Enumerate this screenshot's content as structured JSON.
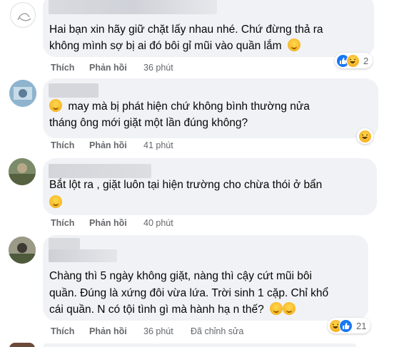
{
  "comments": [
    {
      "text_lines": [
        "Hai bạn xin hãy giữ chặt lấy nhau nhé. Chứ đừng thả ra",
        "không mình sợ bị ai đó bôi gỉ mũi vào quần lắm"
      ],
      "trailing_emoji": "confused-face-icon",
      "actions": {
        "like": "Thích",
        "reply": "Phản hồi",
        "time": "36 phút"
      },
      "reactions": {
        "icons": [
          "like-icon",
          "haha-icon"
        ],
        "count": "2"
      }
    },
    {
      "text_lines": [
        "may mà bị phát hiện chứ không bình thường nửa",
        "tháng ông mới giặt một lần đúng không?"
      ],
      "leading_emoji": "laughing-face-icon",
      "actions": {
        "like": "Thích",
        "reply": "Phản hồi",
        "time": "41 phút"
      },
      "reactions": {
        "icons": [
          "haha-icon"
        ],
        "count": ""
      }
    },
    {
      "text_lines": [
        "Bắt lột ra , giặt luôn tại hiện trường cho chừa thói ở bẩn"
      ],
      "second_line_emoji": "upside-down-face-icon",
      "actions": {
        "like": "Thích",
        "reply": "Phản hồi",
        "time": "40 phút"
      }
    },
    {
      "text_lines": [
        "Chàng thì 5 ngày không giặt, nàng thì cậy cứt mũi bôi",
        "quần. Đúng là xứng đôi vừa lứa. Trời sinh 1 cặp. Chỉ khổ",
        "cái quần. N có tội tình gì mà hành hạ n thế?"
      ],
      "trailing_emojis": [
        "rolling-laughing-icon",
        "rolling-laughing-icon"
      ],
      "actions": {
        "like": "Thích",
        "reply": "Phản hồi",
        "time": "36 phút",
        "edited": "Đã chỉnh sửa"
      },
      "reactions": {
        "icons": [
          "haha-icon",
          "like-icon"
        ],
        "count": "21"
      }
    }
  ],
  "colors": {
    "bubble": "#f0f2f5",
    "action_text": "#65676b",
    "like_blue": "#1877f2",
    "haha_yellow": "#f7b125"
  }
}
